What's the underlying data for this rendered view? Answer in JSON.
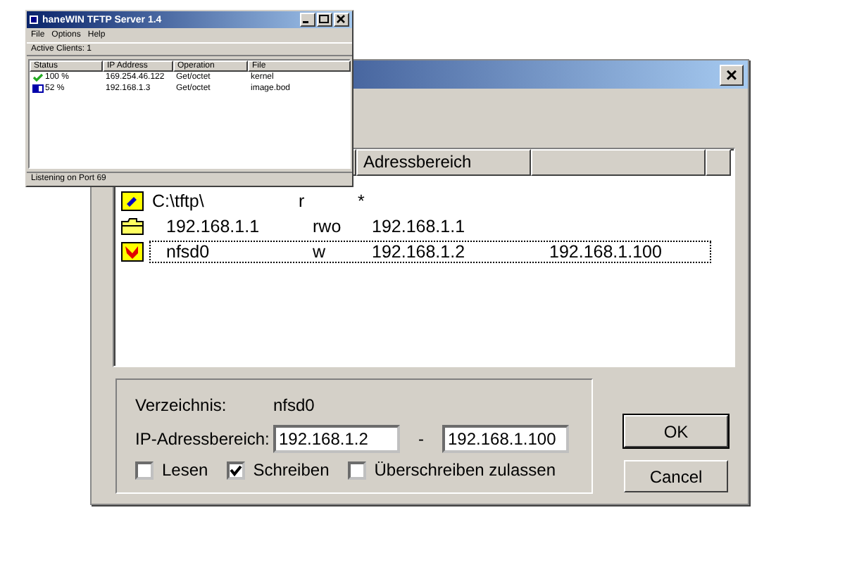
{
  "tftp_window": {
    "title": "haneWIN TFTP Server 1.4",
    "menu": [
      "File",
      "Options",
      "Help"
    ],
    "active_clients": "Active Clients: 1",
    "columns": [
      "Status",
      "IP Address",
      "Operation",
      "File"
    ],
    "rows": [
      {
        "kind": "done",
        "status": "100 %",
        "ip": "169.254.46.122",
        "operation": "Get/octet",
        "file": "kernel"
      },
      {
        "kind": "progress",
        "status": "52 %",
        "ip": "192.168.1.3",
        "operation": "Get/octet",
        "file": "image.bod"
      }
    ],
    "status_bar": "Listening on Port 69"
  },
  "dialog": {
    "close": "×",
    "columns": [
      "Adressbereich"
    ],
    "rows": [
      {
        "kind": "drive",
        "name": "C:\\tftp\\",
        "rights": "r",
        "from": "*",
        "selected": false
      },
      {
        "kind": "folder",
        "name": "192.168.1.1",
        "rights": "rwo",
        "from": "192.168.1.1",
        "selected": false
      },
      {
        "kind": "warning-folder",
        "name": "nfsd0",
        "rights": "w",
        "from": "192.168.1.2",
        "to": "192.168.1.100",
        "selected": true
      }
    ],
    "directory_label": "Verzeichnis:",
    "directory": "nfsd0",
    "range_label": "IP-Adressbereich:",
    "range_from": "192.168.1.2",
    "range_sep": "-",
    "range_to": "192.168.1.100",
    "options": [
      {
        "label": "Lesen",
        "checked": false
      },
      {
        "label": "Schreiben",
        "checked": true
      },
      {
        "label": "Überschreiben zulassen",
        "checked": false
      }
    ],
    "buttons": [
      "OK",
      "Cancel"
    ]
  }
}
